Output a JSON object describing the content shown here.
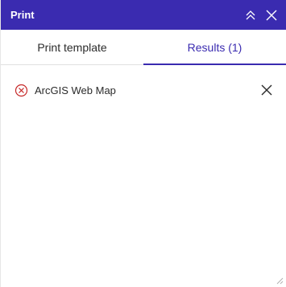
{
  "header": {
    "title": "Print",
    "collapse_icon": "chevrons-up-icon",
    "close_icon": "close-icon",
    "background": "#3a2bb0"
  },
  "tabs": [
    {
      "label": "Print template",
      "active": false
    },
    {
      "label": "Results (1)",
      "active": true
    }
  ],
  "accent": "#3a2bb0",
  "results": [
    {
      "label": "ArcGIS Web Map",
      "status": "error",
      "status_icon": "error-circle-x-icon",
      "status_color": "#c62828",
      "remove_icon": "close-icon"
    }
  ]
}
